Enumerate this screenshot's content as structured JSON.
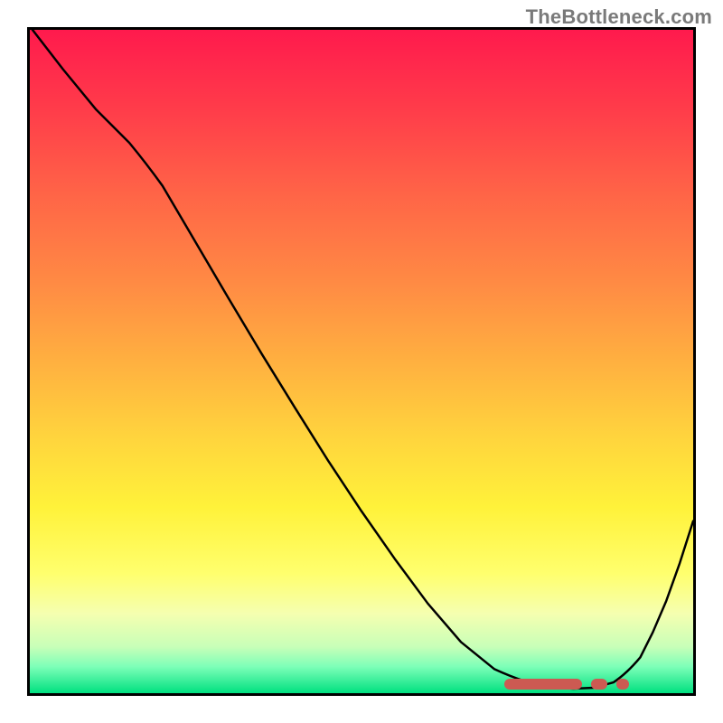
{
  "watermark": "TheBottleneck.com",
  "chart_data": {
    "type": "line",
    "title": "",
    "xlabel": "",
    "ylabel": "",
    "xlim": [
      0,
      100
    ],
    "ylim": [
      0,
      100
    ],
    "x": [
      0,
      5,
      10,
      15,
      20,
      25,
      30,
      35,
      40,
      45,
      50,
      55,
      60,
      65,
      70,
      75,
      80,
      82,
      84,
      86,
      88,
      90,
      92,
      94,
      96,
      98,
      100
    ],
    "y": [
      99,
      94,
      89,
      84,
      79,
      72,
      64,
      56,
      48,
      40,
      32,
      24,
      17,
      11,
      6,
      3,
      1,
      0.5,
      0.5,
      0.5,
      0.5,
      1,
      3,
      8,
      14,
      20,
      27
    ],
    "markers_x_range": [
      71,
      90
    ],
    "note": "Curve descends from top-left to a valley near x≈82–88 then rises; y interpreted as distance from optimum (0 best, 100 worst). Red markers along bottom indicate data points in valley.",
    "colors": {
      "curve": "#000000",
      "markers": "#cc5a52",
      "gradient_top": "#ff1a4d",
      "gradient_mid": "#ffd63d",
      "gradient_bottom": "#00e080",
      "frame": "#000000"
    }
  }
}
